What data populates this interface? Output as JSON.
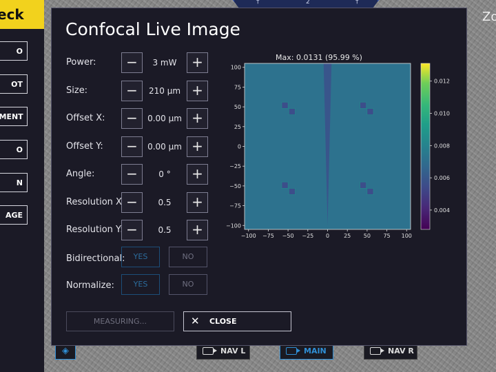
{
  "sidebar": {
    "brand": "eck",
    "buttons": [
      "O",
      "OT",
      "EMENT",
      "O",
      "N",
      "AGE"
    ]
  },
  "top": {
    "marks": [
      "†",
      "2",
      "†"
    ]
  },
  "zoom_label": "Zo",
  "bottom_bar": {
    "nav_l": "NAV L",
    "main": "MAIN",
    "nav_r": "NAV R",
    "location_icon": "location-icon",
    "camera_icon": "camera-icon"
  },
  "dialog": {
    "title": "Confocal Live Image",
    "rows": [
      {
        "label": "Power:",
        "value": "3 mW"
      },
      {
        "label": "Size:",
        "value": "210 µm"
      },
      {
        "label": "Offset X:",
        "value": "0.00 µm"
      },
      {
        "label": "Offset Y:",
        "value": "0.00 µm"
      },
      {
        "label": "Angle:",
        "value": "0 °"
      },
      {
        "label": "Resolution X:",
        "value": "0.5"
      },
      {
        "label": "Resolution Y:",
        "value": "0.5"
      }
    ],
    "minus": "−",
    "plus": "+",
    "bidirectional": {
      "label": "Bidirectional:",
      "yes": "YES",
      "no": "NO",
      "selected": "YES"
    },
    "normalize": {
      "label": "Normalize:",
      "yes": "YES",
      "no": "NO",
      "selected": "YES"
    },
    "measuring_label": "MEASURING...",
    "close_label": "CLOSE",
    "close_icon": "✕"
  },
  "chart_data": {
    "type": "heatmap",
    "title": "Max: 0.0131 (95.99 %)",
    "xlim": [
      -105,
      105
    ],
    "ylim": [
      -105,
      105
    ],
    "xticks": [
      -100,
      -75,
      -50,
      -25,
      0,
      25,
      50,
      75,
      100
    ],
    "yticks": [
      100,
      75,
      50,
      25,
      0,
      -25,
      -50,
      -75,
      -100
    ],
    "colorbar": {
      "min": 0.0028,
      "max": 0.0131,
      "ticks": [
        0.012,
        0.01,
        0.008,
        0.006,
        0.004
      ]
    },
    "colormap": "viridis",
    "background_value": 0.0072,
    "features": [
      {
        "kind": "low_square",
        "center": [
          -54,
          52
        ],
        "size": 8
      },
      {
        "kind": "low_square",
        "center": [
          -45,
          44
        ],
        "size": 8
      },
      {
        "kind": "low_square",
        "center": [
          45,
          52
        ],
        "size": 8
      },
      {
        "kind": "low_square",
        "center": [
          54,
          44
        ],
        "size": 8
      },
      {
        "kind": "low_square",
        "center": [
          -54,
          -49
        ],
        "size": 8
      },
      {
        "kind": "low_square",
        "center": [
          -45,
          -57
        ],
        "size": 8
      },
      {
        "kind": "low_square",
        "center": [
          45,
          -49
        ],
        "size": 8
      },
      {
        "kind": "low_square",
        "center": [
          54,
          -57
        ],
        "size": 8
      },
      {
        "kind": "low_wedge",
        "top_x": [
          -5,
          5
        ],
        "bottom_x": [
          0,
          0
        ],
        "y_range": [
          -100,
          105
        ]
      }
    ]
  }
}
